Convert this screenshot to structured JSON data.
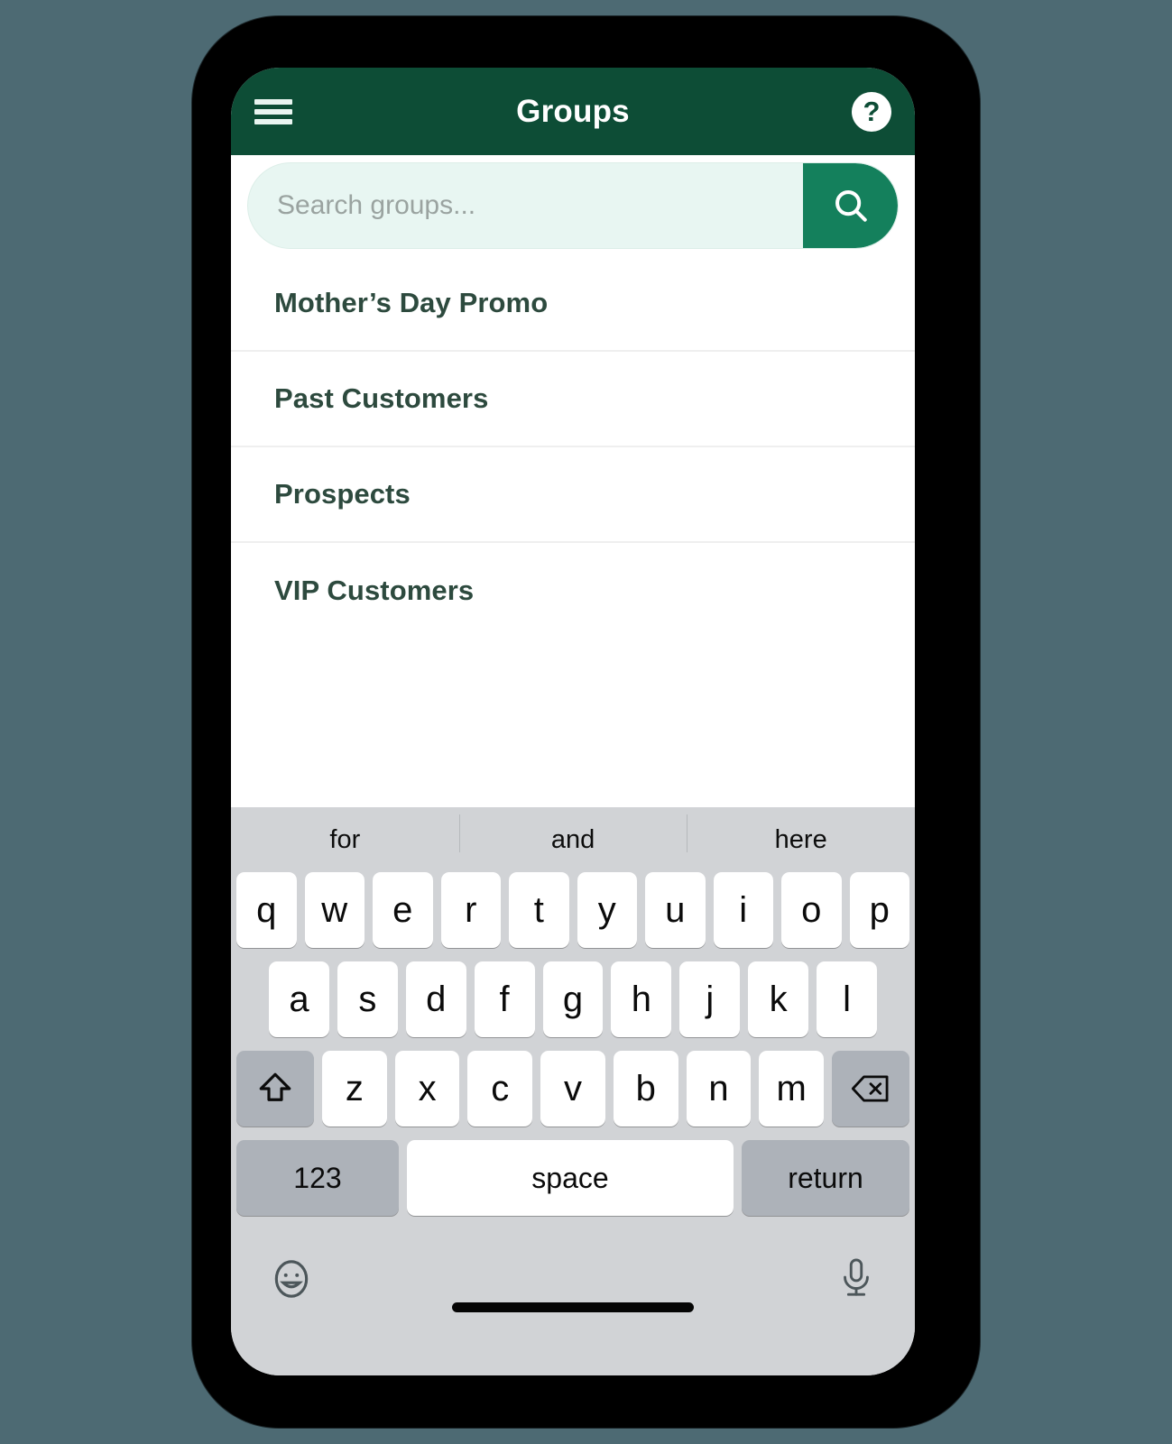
{
  "theme": {
    "page_background": "#4d6a73",
    "appbar_green": "#0d4d36",
    "accent_green": "#14805c",
    "search_field_bg": "#e8f6f2",
    "list_text": "#2d4a3e",
    "keyboard_bg": "#d1d3d6",
    "key_white": "#ffffff",
    "key_gray": "#adb2b9"
  },
  "appbar": {
    "title": "Groups",
    "menu_icon": "hamburger-menu-icon",
    "help_icon": "help-question-icon",
    "help_label": "?"
  },
  "search": {
    "placeholder": "Search groups...",
    "value": "",
    "button_icon": "search-icon"
  },
  "groups": {
    "items": [
      {
        "label": "Mother’s Day Promo"
      },
      {
        "label": "Past Customers"
      },
      {
        "label": "Prospects"
      },
      {
        "label": "VIP Customers"
      }
    ]
  },
  "keyboard": {
    "suggestions": [
      "for",
      "and",
      "here"
    ],
    "row1": [
      "q",
      "w",
      "e",
      "r",
      "t",
      "y",
      "u",
      "i",
      "o",
      "p"
    ],
    "row2": [
      "a",
      "s",
      "d",
      "f",
      "g",
      "h",
      "j",
      "k",
      "l"
    ],
    "row3_letters": [
      "z",
      "x",
      "c",
      "v",
      "b",
      "n",
      "m"
    ],
    "shift_icon": "shift-arrow-icon",
    "backspace_icon": "backspace-delete-icon",
    "numbers_label": "123",
    "space_label": "space",
    "return_label": "return",
    "emoji_icon": "emoji-smiley-icon",
    "mic_icon": "microphone-icon"
  }
}
